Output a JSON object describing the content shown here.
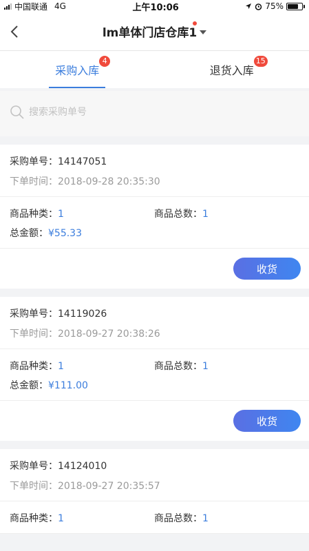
{
  "status_bar": {
    "carrier": "中国联通",
    "network": "4G",
    "time": "上午10:06",
    "battery": "75%",
    "battery_level": 0.75
  },
  "nav": {
    "title": "lm单体门店仓库1",
    "back_icon": "chevron-left-icon",
    "dropdown_icon": "caret-down-icon"
  },
  "tabs": [
    {
      "label": "采购入库",
      "badge": "4",
      "active": true
    },
    {
      "label": "退货入库",
      "badge": "15",
      "active": false
    }
  ],
  "search": {
    "placeholder": "搜索采购单号",
    "value": ""
  },
  "labels": {
    "order_no": "采购单号：",
    "order_time": "下单时间：",
    "sku_types": "商品种类：",
    "sku_total": "商品总数：",
    "total_amount": "总金额：",
    "receive_button": "收货"
  },
  "orders": [
    {
      "order_no": "14147051",
      "time": "2018-09-28 20:35:30",
      "sku_types": "1",
      "sku_total": "1",
      "amount": "¥55.33"
    },
    {
      "order_no": "14119026",
      "time": "2018-09-27 20:38:26",
      "sku_types": "1",
      "sku_total": "1",
      "amount": "¥111.00"
    },
    {
      "order_no": "14124010",
      "time": "2018-09-27 20:35:57",
      "sku_types": "1",
      "sku_total": "1",
      "amount": ""
    }
  ],
  "colors": {
    "accent": "#3b7ddd",
    "badge": "#f04a3c"
  }
}
